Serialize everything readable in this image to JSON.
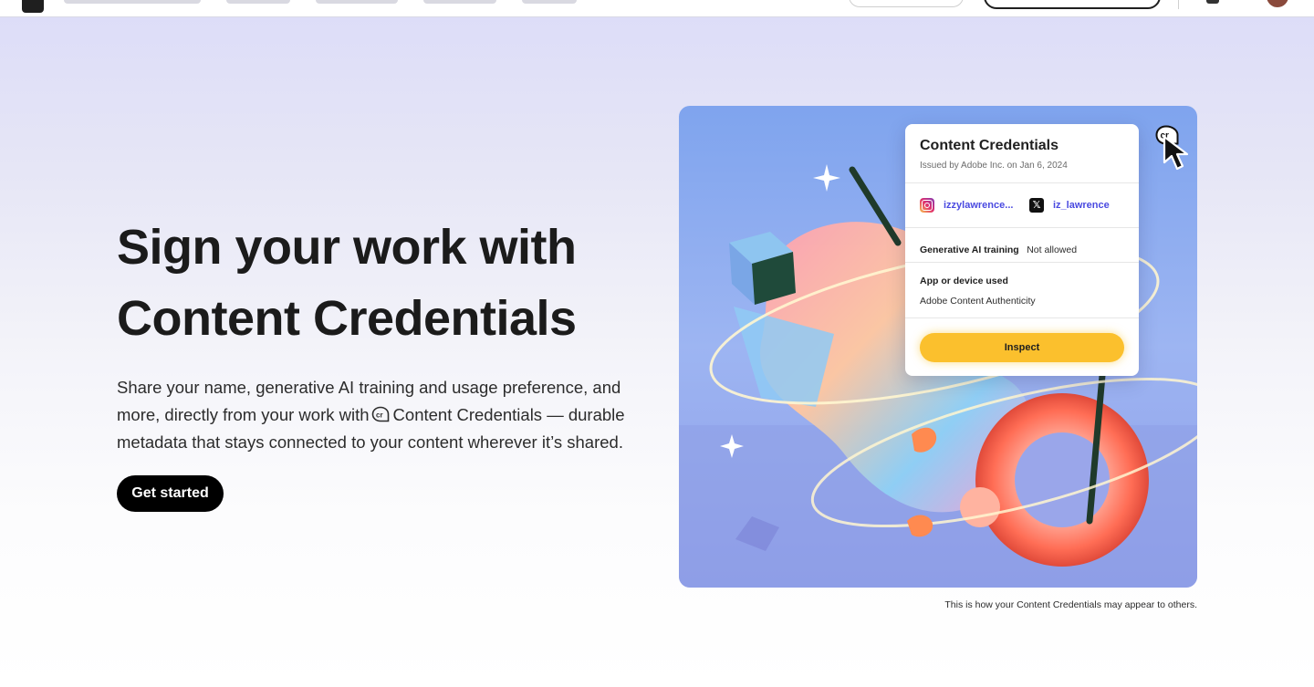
{
  "hero": {
    "title_line1": "Sign your work with",
    "title_line2": "Content Credentials",
    "desc_part1": "Share your name, generative AI training and usage preference, and more, directly from your work with",
    "desc_part2": "Content Credentials — durable metadata that stays connected to your content wherever it’s shared.",
    "cta_label": "Get started"
  },
  "card": {
    "title": "Content Credentials",
    "issued": "Issued by Adobe Inc. on Jan 6, 2024",
    "instagram_handle": "izzylawrence...",
    "x_handle": "iz_lawrence",
    "x_glyph": "𝕏",
    "ai_training_label": "Generative AI training",
    "ai_training_value": "Not allowed",
    "app_label": "App or device used",
    "app_value": "Adobe Content Authenticity",
    "inspect_label": "Inspect"
  },
  "badge_text": "cr",
  "caption": "This is how your Content Credentials may appear to others.",
  "colors": {
    "accent_yellow": "#fbc02d",
    "link_purple": "#4a4ae0",
    "cta_black": "#000000"
  }
}
